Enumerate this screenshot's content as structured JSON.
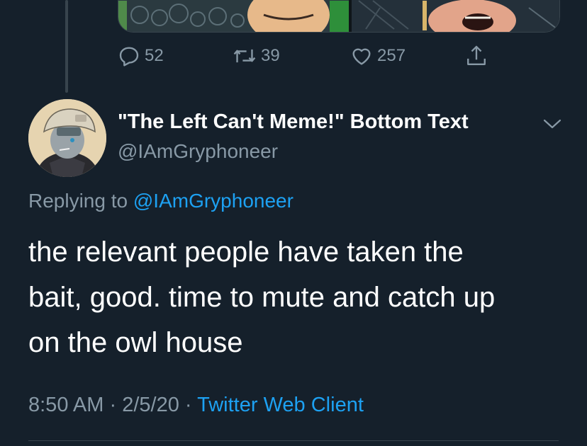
{
  "colors": {
    "background": "#15202b",
    "text_primary": "#ffffff",
    "text_secondary": "#8899a6",
    "accent": "#1da1f2",
    "divider": "#38444d"
  },
  "previous_tweet": {
    "reply_count": "52",
    "retweet_count": "39",
    "like_count": "257",
    "icons": [
      "reply-icon",
      "retweet-icon",
      "like-icon",
      "share-icon"
    ]
  },
  "tweet": {
    "display_name": "\"The Left Can't Meme!\" Bottom Text",
    "handle": "@IAmGryphoneer",
    "replying_label": "Replying to",
    "replying_to": "@IAmGryphoneer",
    "text_lines": [
      "the relevant people have taken the",
      "bait, good. time to mute and catch up",
      "on the owl house"
    ],
    "time": "8:50 AM",
    "separator": "·",
    "date": "2/5/20",
    "client": "Twitter Web Client",
    "menu_icon": "chevron-down-icon"
  }
}
